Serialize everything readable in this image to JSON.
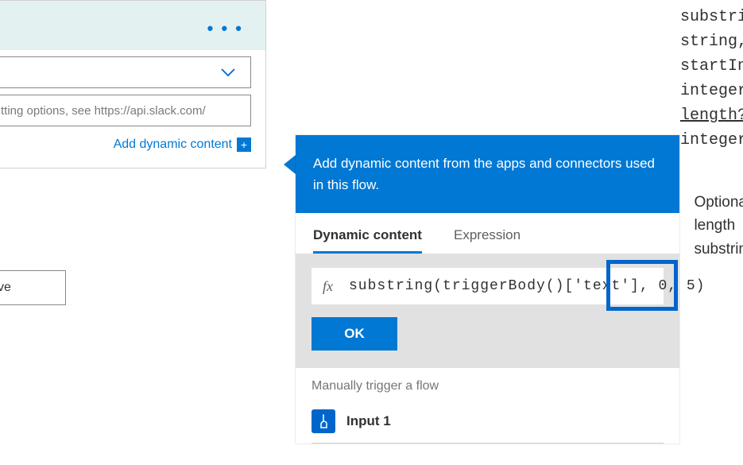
{
  "action_card": {
    "menu_dots": "• • •",
    "dropdown_value": "",
    "input_placeholder": "tting options, see https://api.slack.com/",
    "add_dynamic_label": "Add dynamic content"
  },
  "save_button_label": "ve",
  "dyn_panel": {
    "header_text": "Add dynamic content from the apps and connectors used in this flow.",
    "tabs": {
      "dynamic": "Dynamic content",
      "expression": "Expression"
    },
    "fx_label": "fx",
    "expression_value": "substring(triggerBody()['text'], 0, 5)",
    "ok_label": "OK",
    "section_label": "Manually trigger a flow",
    "items": [
      {
        "label": "Input 1"
      }
    ]
  },
  "signature": {
    "lines": [
      "substri",
      "string,",
      "startIn",
      "integer",
      "length?",
      "integer"
    ],
    "desc": [
      "Optiona",
      "length",
      "substrin"
    ]
  },
  "chart_data": null
}
